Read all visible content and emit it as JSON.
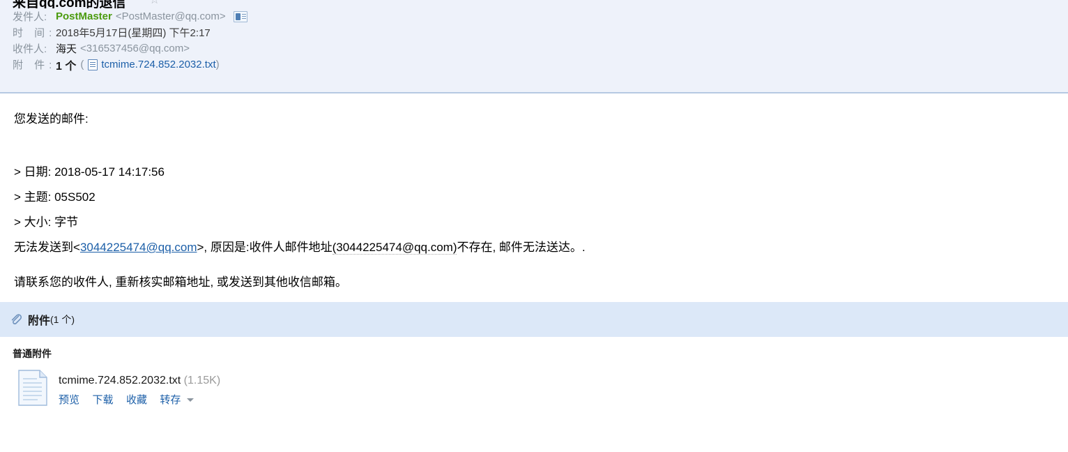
{
  "header": {
    "subject": "来自qq.com的退信",
    "star_icon": "star-outline-icon",
    "rows": {
      "from_label": "发件人:",
      "from_name": "PostMaster",
      "from_address": "<PostMaster@qq.com>",
      "contact_icon": "contact-card-icon",
      "time_label": "时 间:",
      "time_value": "2018年5月17日(星期四) 下午2:17",
      "to_label": "收件人:",
      "to_name": "海天",
      "to_address": "<316537456@qq.com>",
      "attach_label": "附 件:",
      "attach_count": "1 个",
      "attach_open_paren": "(",
      "attach_file_icon": "text-file-icon",
      "attach_filename": "tcmime.724.852.2032.txt",
      "attach_close_paren": ")"
    }
  },
  "body": {
    "intro": "您发送的邮件:",
    "quote_date": "> 日期: 2018-05-17 14:17:56",
    "quote_subject": "> 主题: 05S502",
    "quote_size": "> 大小: 字节",
    "error_prefix": "无法发送到<",
    "error_email": "3044225474@qq.com",
    "error_middle": ">, 原因是:收件人邮件地址",
    "error_smart_tag": "(3044225474@qq.com)",
    "error_suffix": "不存在, 邮件无法送达。.",
    "advice": "请联系您的收件人, 重新核实邮箱地址, 或发送到其他收信邮箱。"
  },
  "attachments": {
    "bar_icon": "paperclip-icon",
    "bar_title": "附件",
    "bar_count": "(1 个)",
    "group_title": "普通附件",
    "items": [
      {
        "icon": "document-icon",
        "filename": "tcmime.724.852.2032.txt",
        "size": "(1.15K)",
        "actions": [
          "预览",
          "下载",
          "收藏",
          "转存"
        ],
        "dropdown_icon": "caret-down-icon"
      }
    ]
  },
  "colors": {
    "header_bg": "#eef2fa",
    "header_border": "#b6c9e2",
    "attach_bar_bg": "#dce8f8",
    "link_blue": "#1c5fa8",
    "sender_green": "#4b9b0f",
    "label_gray": "#8a949e"
  }
}
